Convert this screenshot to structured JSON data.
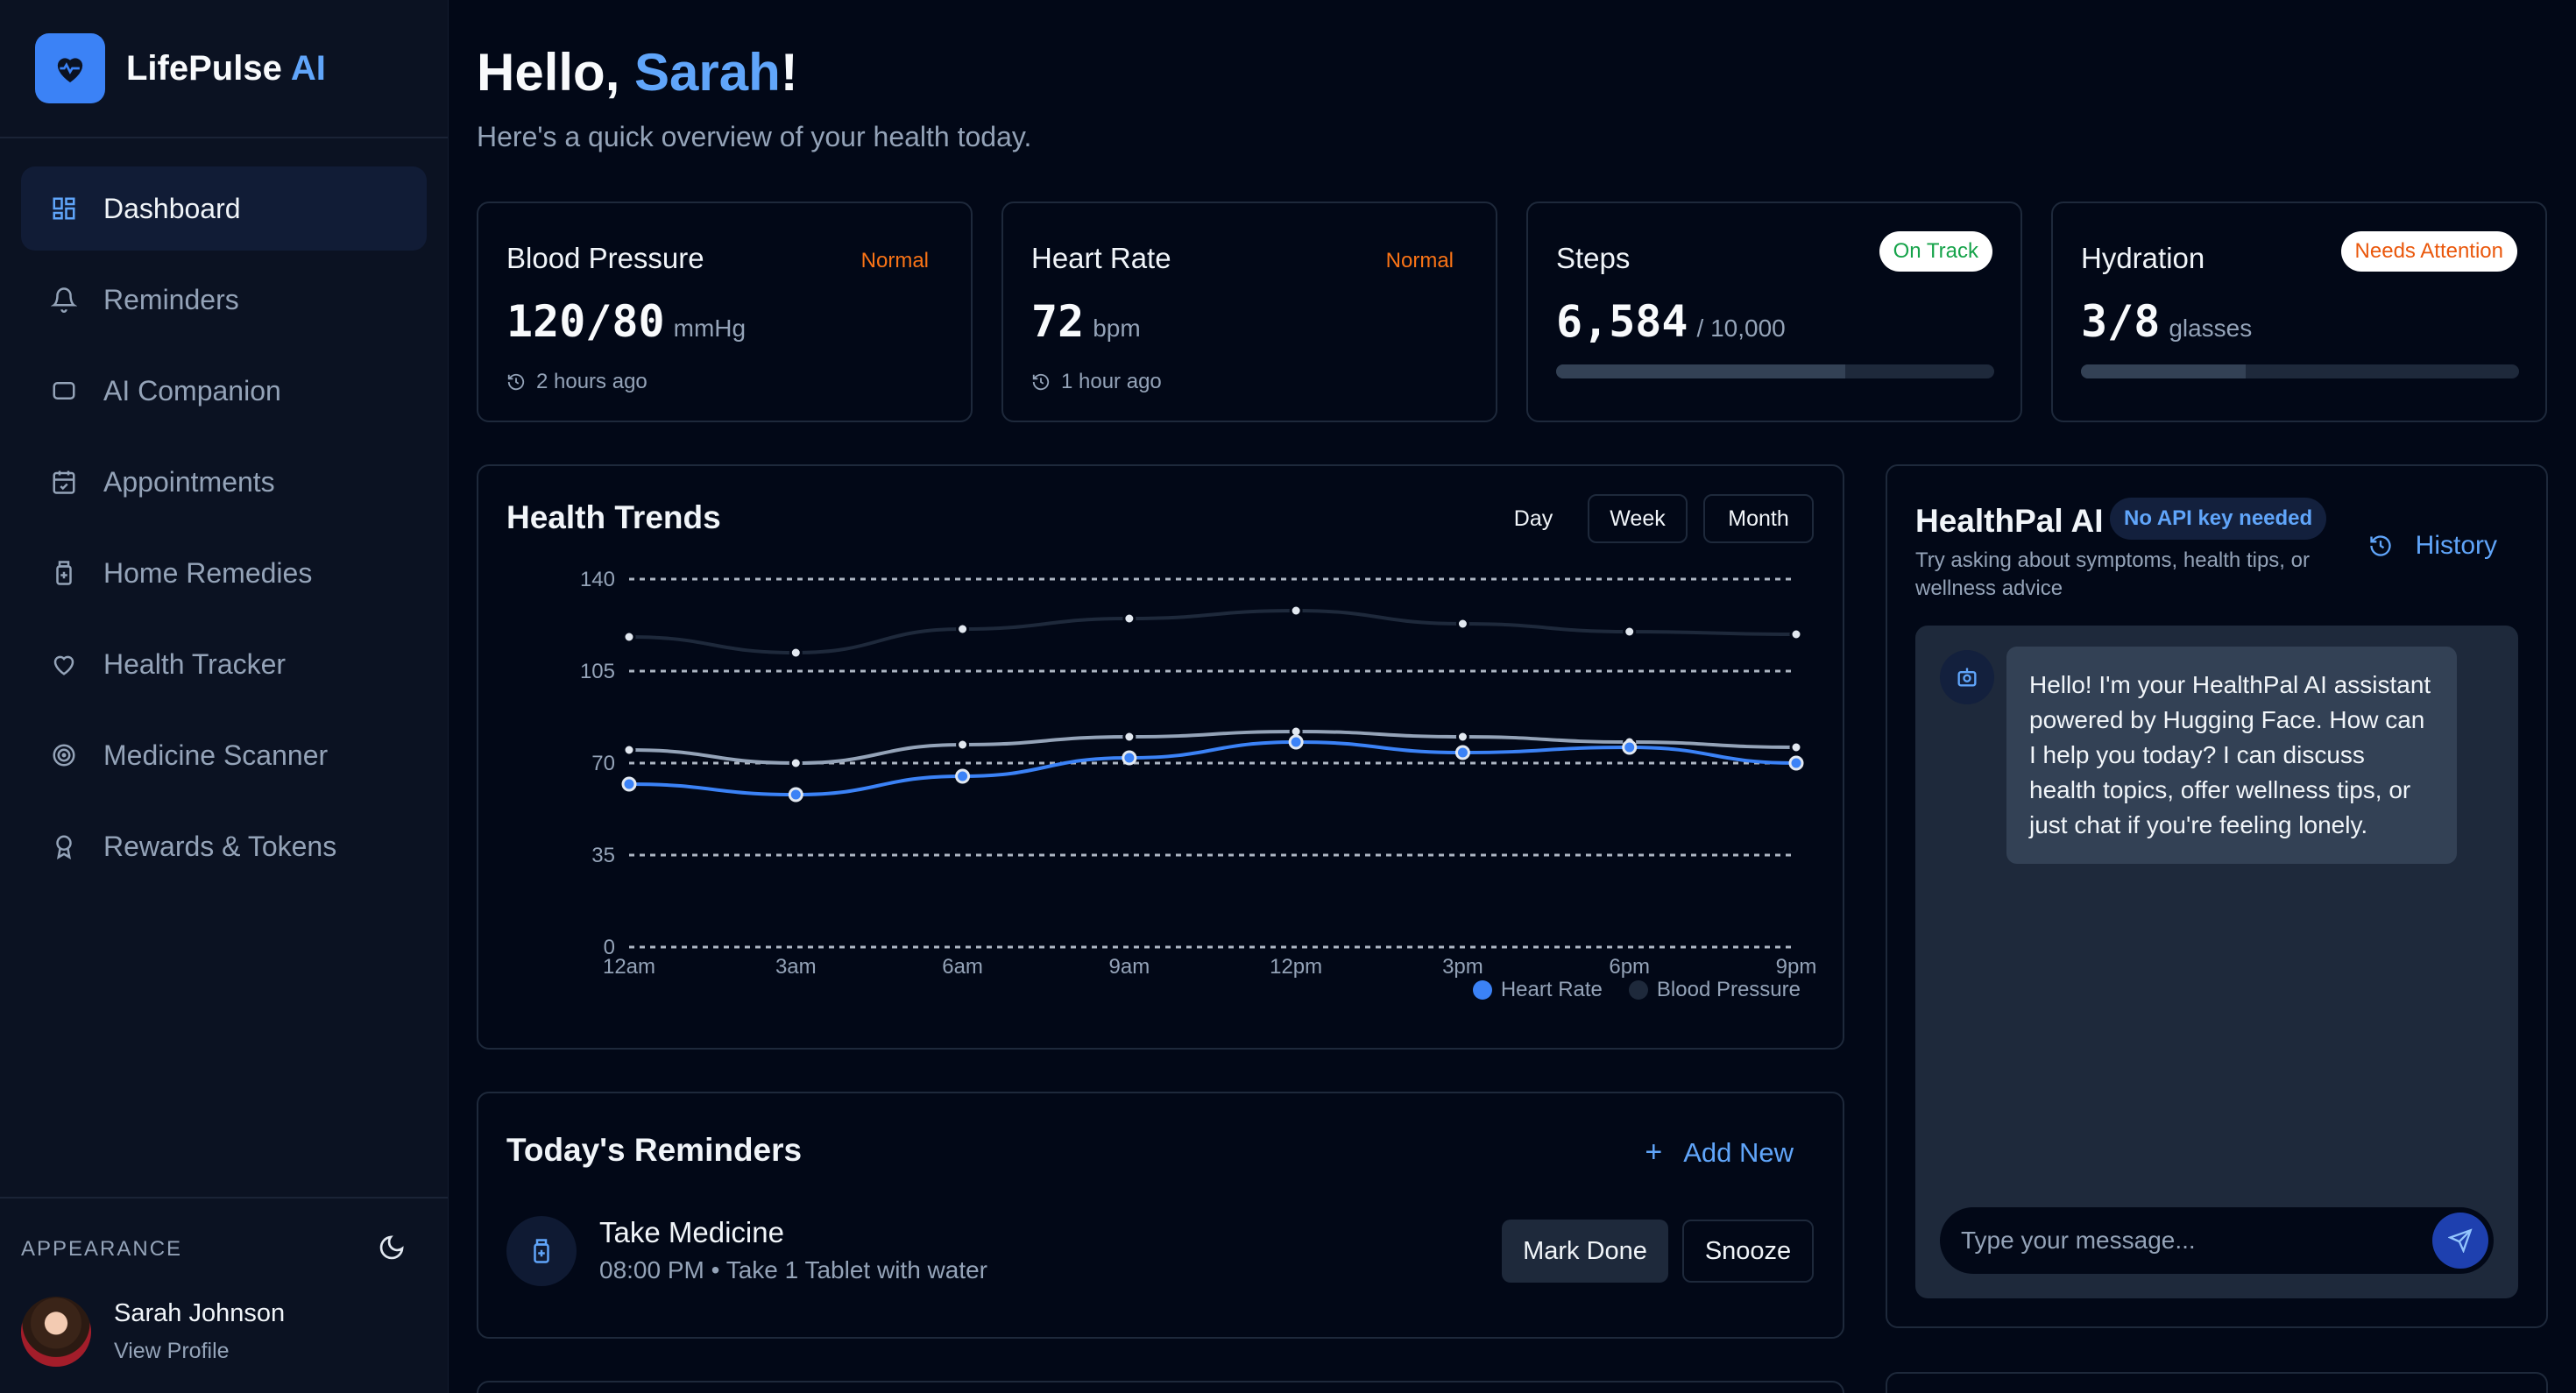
{
  "brand": {
    "name": "LifePulse",
    "ai": "AI"
  },
  "sidebar": {
    "items": [
      {
        "label": "Dashboard",
        "icon": "dashboard-icon"
      },
      {
        "label": "Reminders",
        "icon": "bell-icon"
      },
      {
        "label": "AI Companion",
        "icon": "chat-icon"
      },
      {
        "label": "Appointments",
        "icon": "calendar-icon"
      },
      {
        "label": "Home Remedies",
        "icon": "remedy-icon"
      },
      {
        "label": "Health Tracker",
        "icon": "heart-icon"
      },
      {
        "label": "Medicine Scanner",
        "icon": "scanner-icon"
      },
      {
        "label": "Rewards & Tokens",
        "icon": "award-icon"
      }
    ],
    "appearance_label": "APPEARANCE",
    "profile": {
      "name": "Sarah Johnson",
      "link": "View Profile"
    }
  },
  "header": {
    "greeting_prefix": "Hello, ",
    "user": "Sarah",
    "greeting_suffix": "!",
    "subtitle": "Here's a quick overview of your health today."
  },
  "stats": {
    "bp": {
      "title": "Blood Pressure",
      "badge": "Normal",
      "value": "120/80",
      "unit": "mmHg",
      "time": "2 hours ago"
    },
    "hr": {
      "title": "Heart Rate",
      "badge": "Normal",
      "value": "72",
      "unit": "bpm",
      "time": "1 hour ago"
    },
    "steps": {
      "title": "Steps",
      "badge": "On Track",
      "value": "6,584",
      "unit": "/ 10,000",
      "progress": 0.66
    },
    "hydration": {
      "title": "Hydration",
      "badge": "Needs Attention",
      "value": "3/8",
      "unit": "glasses",
      "progress": 0.375
    }
  },
  "trends": {
    "title": "Health Trends",
    "ranges": [
      "Day",
      "Week",
      "Month"
    ]
  },
  "chart_data": {
    "type": "line",
    "categories": [
      "12am",
      "3am",
      "6am",
      "9am",
      "12pm",
      "3pm",
      "6pm",
      "9pm"
    ],
    "ylim": [
      0,
      140
    ],
    "yticks": [
      0,
      35,
      70,
      105,
      140
    ],
    "series": [
      {
        "name": "Heart Rate",
        "color": "#3b82f6",
        "values": [
          62,
          58,
          65,
          72,
          78,
          74,
          76,
          70
        ]
      },
      {
        "name": "Blood Pressure",
        "color": "#1e293b",
        "values": [
          118,
          112,
          121,
          125,
          128,
          123,
          120,
          119
        ]
      },
      {
        "name": "",
        "color": "#94a3b8",
        "values": [
          75,
          70,
          77,
          80,
          82,
          80,
          78,
          76
        ]
      }
    ],
    "legend": [
      "Heart Rate",
      "Blood Pressure"
    ],
    "grid": true
  },
  "reminders": {
    "title": "Today's Reminders",
    "add_label": "Add New",
    "items": [
      {
        "title": "Take Medicine",
        "subtitle": "08:00 PM • Take 1 Tablet with water",
        "done_label": "Mark Done",
        "snooze_label": "Snooze"
      }
    ]
  },
  "chat": {
    "title": "HealthPal AI",
    "badge": "No API key needed",
    "subtitle": "Try asking about symptoms, health tips, or wellness advice",
    "history_label": "History",
    "message": "Hello! I'm your HealthPal AI assistant powered by Hugging Face. How can I help you today? I can discuss health topics, offer wellness tips, or just chat if you're feeling lonely.",
    "placeholder": "Type your message..."
  }
}
